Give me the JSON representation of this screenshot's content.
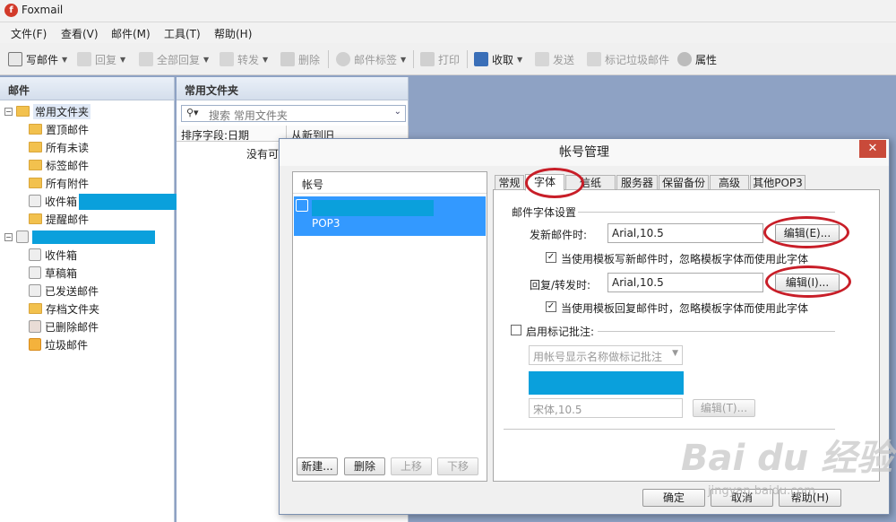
{
  "app": {
    "title": "Foxmail"
  },
  "menu": [
    "文件(F)",
    "查看(V)",
    "邮件(M)",
    "工具(T)",
    "帮助(H)"
  ],
  "toolbar": {
    "compose": "写邮件",
    "reply": "回复",
    "reply_all": "全部回复",
    "forward": "转发",
    "delete": "删除",
    "tag": "邮件标签",
    "print": "打印",
    "receive": "收取",
    "send": "发送",
    "junk": "标记垃圾邮件",
    "props": "属性"
  },
  "left": {
    "header": "邮件",
    "common_folder": "常用文件夹",
    "items_common": [
      "置顶邮件",
      "所有未读",
      "标签邮件",
      "所有附件",
      "收件箱",
      "提醒邮件"
    ],
    "items_account": [
      "收件箱",
      "草稿箱",
      "已发送邮件",
      "存档文件夹",
      "已删除邮件",
      "垃圾邮件"
    ]
  },
  "mid": {
    "header": "常用文件夹",
    "search_placeholder": "搜索 常用文件夹",
    "sort_label": "排序字段:日期",
    "order_label": "从新到旧",
    "empty_text": "没有可"
  },
  "dialog": {
    "title": "帐号管理",
    "close": "✕",
    "account_header": "帐号",
    "account_type": "POP3",
    "btn_new": "新建...",
    "btn_delete": "删除",
    "btn_up": "上移",
    "btn_down": "下移",
    "tabs": [
      "常规",
      "字体",
      "信纸",
      "服务器",
      "保留备份",
      "高级",
      "其他POP3"
    ],
    "active_tab": "字体",
    "section_title": "邮件字体设置",
    "new_mail_label": "发新邮件时:",
    "new_mail_font": "Arial,10.5",
    "edit_e": "编辑(E)...",
    "chk_new_text": "当使用模板写新邮件时，忽略模板字体而使用此字体",
    "reply_label": "回复/转发时:",
    "reply_font": "Arial,10.5",
    "edit_i": "编辑(I)...",
    "chk_reply_text": "当使用模板回复邮件时，忽略模板字体而使用此字体",
    "mark_label": "启用标记批注:",
    "mark_select": "用帐号显示名称做标记批注",
    "mark_font": "宋体,10.5",
    "edit_t": "编辑(T)...",
    "ok": "确定",
    "cancel": "取消",
    "help": "帮助(H)"
  },
  "watermark": {
    "logo": "Bai du 经验",
    "url": "jingyan.baidu.com"
  },
  "colors": {
    "redact": "#0aa0dc",
    "highlight": "#c81e28",
    "selected": "#3399ff"
  }
}
